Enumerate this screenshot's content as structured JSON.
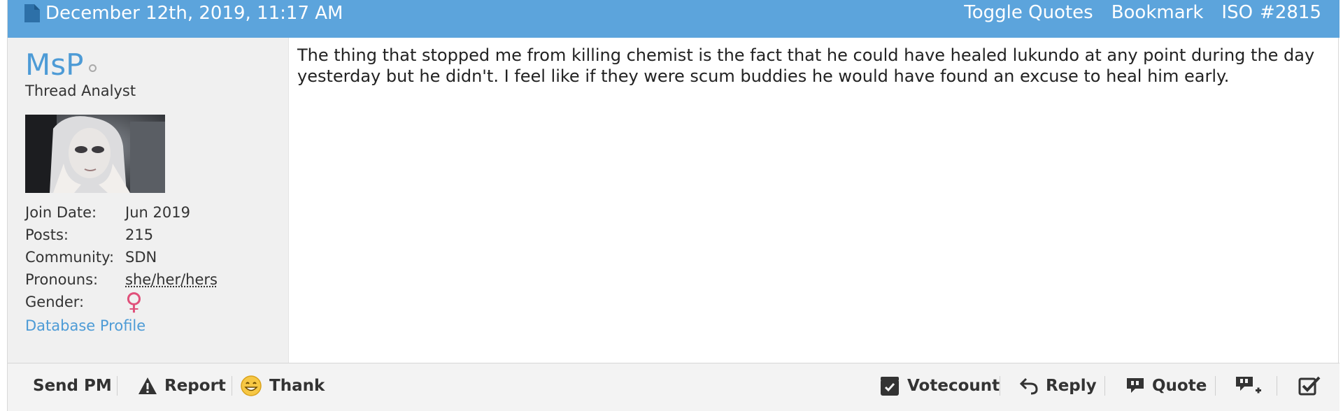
{
  "header": {
    "timestamp": "December 12th, 2019, 11:17 AM",
    "actions": [
      "Toggle Quotes",
      "Bookmark",
      "ISO",
      "#2815"
    ]
  },
  "user": {
    "name": "MsP",
    "title": "Thread Analyst",
    "stats": [
      {
        "label": "Join Date:",
        "value": "Jun 2019"
      },
      {
        "label": "Posts:",
        "value": "215"
      },
      {
        "label": "Community:",
        "value": "SDN"
      },
      {
        "label": "Pronouns:",
        "value": "she/her/hers"
      },
      {
        "label": "Gender:",
        "value": "♀"
      }
    ],
    "profile_link": "Database Profile"
  },
  "post": {
    "text": "The thing that stopped me from killing chemist is the fact that he could have healed lukundo at any point during the day yesterday but he didn't. I feel like if they were scum buddies he would have found an excuse to heal him early."
  },
  "footer": {
    "send_pm": "Send PM",
    "report": "Report",
    "thank": "Thank",
    "votecount": "Votecount",
    "reply": "Reply",
    "quote": "Quote"
  },
  "colors": {
    "header_bg": "#5ca4dc",
    "link": "#4d9bd6",
    "sidebar_bg": "#f0f0f0",
    "gender": "#e0507a"
  },
  "icons": [
    "document-icon",
    "online-status-icon",
    "warning-icon",
    "thank-smiley-icon",
    "votecount-icon",
    "reply-arrow-icon",
    "quote-icon",
    "multi-quote-icon",
    "checkbox-select-icon"
  ]
}
